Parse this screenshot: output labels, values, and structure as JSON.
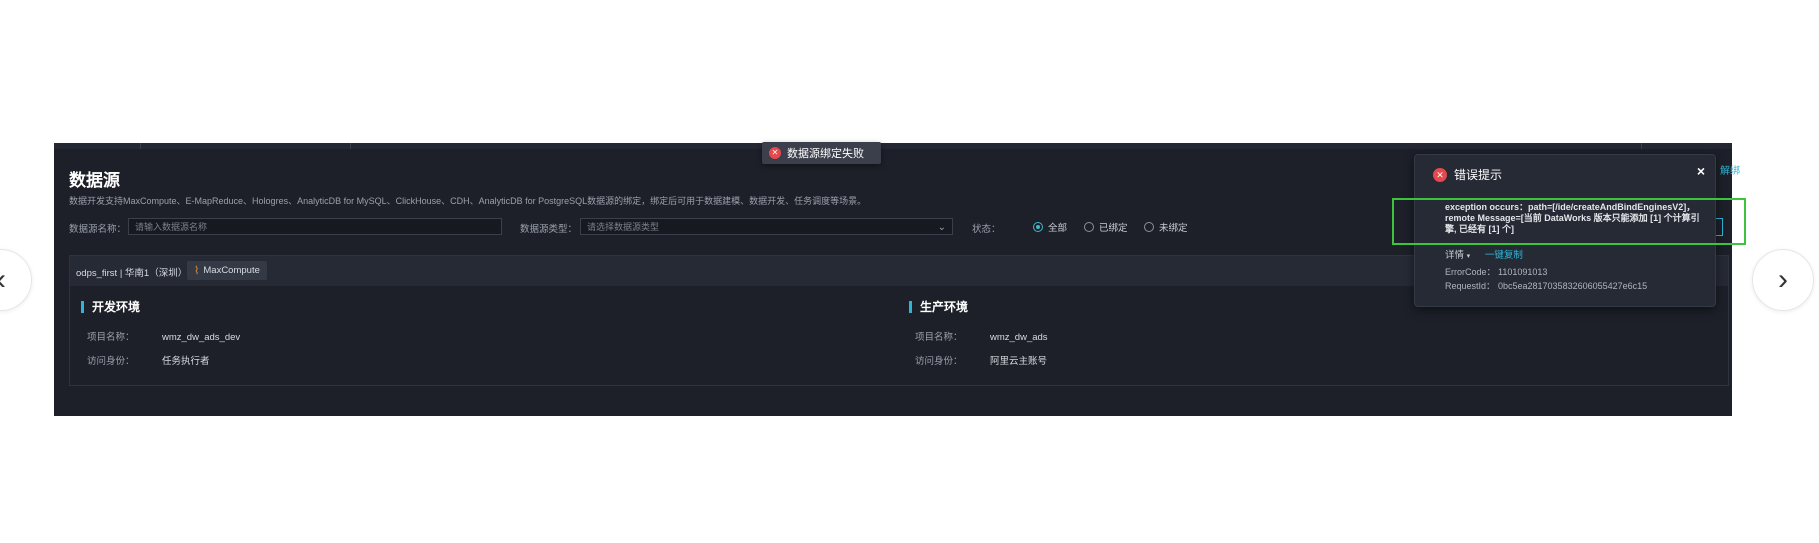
{
  "carousel": {
    "prev_glyph": "‹",
    "next_glyph": "›"
  },
  "page": {
    "title": "数据源",
    "description": "数据开发支持MaxCompute、E-MapReduce、Hologres、AnalyticDB for MySQL、ClickHouse、CDH、AnalyticDB for PostgreSQL数据源的绑定，绑定后可用于数据建模、数据开发、任务调度等场景。"
  },
  "filters": {
    "name_label": "数据源名称：",
    "name_placeholder": "请输入数据源名称",
    "type_label": "数据源类型：",
    "type_placeholder": "请选择数据源类型",
    "status_label": "状态：",
    "status_options": [
      "全部",
      "已绑定",
      "未绑定"
    ],
    "status_selected": "全部"
  },
  "datasource": {
    "name": "odps_first | 华南1（深圳）",
    "engine": "MaxCompute",
    "dev": {
      "title": "开发环境",
      "project_label": "项目名称：",
      "project_value": "wmz_dw_ads_dev",
      "identity_label": "访问身份：",
      "identity_value": "任务执行者"
    },
    "prod": {
      "title": "生产环境",
      "project_label": "项目名称：",
      "project_value": "wmz_dw_ads",
      "identity_label": "访问身份：",
      "identity_value": "阿里云主账号"
    }
  },
  "toast": {
    "text": "数据源绑定失败"
  },
  "right_link": "解绑",
  "error_notification": {
    "title": "错误提示",
    "close_glyph": "×",
    "message": "exception occurs：path=[/ide/createAndBindEnginesV2]，remote Message=[当前 DataWorks 版本只能添加 [1] 个计算引擎, 已经有 [1] 个]",
    "detail_label": "详情",
    "copy_label": "一键复制",
    "error_code_label": "ErrorCode：",
    "error_code": "1101091013",
    "request_id_label": "RequestId：",
    "request_id": "0bc5ea281703583260605542​7e6c15"
  }
}
